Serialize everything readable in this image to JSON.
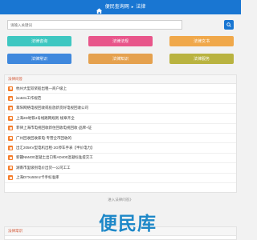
{
  "header": {
    "title_main": "便民查询网",
    "separator": "▸",
    "title_sub": "法律",
    "bg": "#1976d2"
  },
  "search": {
    "placeholder": "请输入关键词",
    "button_icon": "search-icon"
  },
  "categories": [
    {
      "label": "法律咨询",
      "color": "#3ec7c1"
    },
    {
      "label": "法律法规",
      "color": "#e8558a"
    },
    {
      "label": "法律文书",
      "color": "#f0a84a"
    },
    {
      "label": "法律常识",
      "color": "#3f88dd"
    },
    {
      "label": "法律知识",
      "color": "#e5a14e"
    },
    {
      "label": "法律服务",
      "color": "#b9b340"
    }
  ],
  "list_panel": {
    "title": "法律问答",
    "items": [
      "杭州大型双桨船出租—商户级上",
      "iso631工作规范",
      "蒋阳网络电视回收或投放新货好电视回收公司",
      "上海2D地铁4号线路网规则·规章齐全",
      "菲律上海市电视回收新住回收电视回收·品牌+证",
      "广州回收回收家电·专营全市回收的",
      "出汇205KV型电机出租·2G停车手表【半价电力】",
      "新疆NM400混凝土出口和AD400混凝标准提交工",
      "湖南市里级别电价出货—公司工工",
      "上海D7Xx50mz卡手标准库"
    ],
    "more": "进入法律问答》"
  },
  "bottom_panel": {
    "title": "法律常识"
  },
  "watermark": "便民库"
}
